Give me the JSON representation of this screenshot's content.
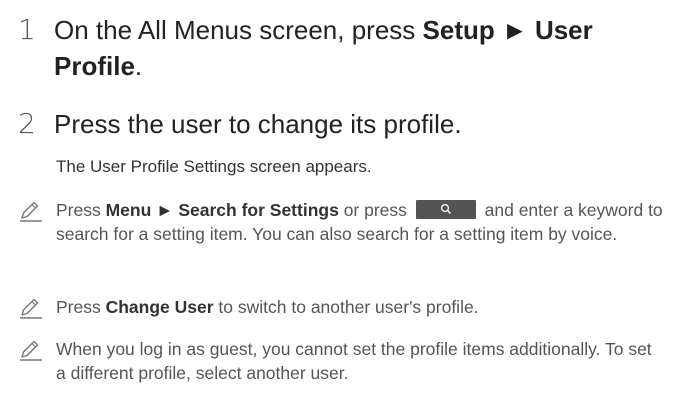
{
  "steps": [
    {
      "number": "1",
      "text_before": "On the All Menus screen, press ",
      "bold1": "Setup",
      "arrow": " ► ",
      "bold2": "User Profile",
      "text_after": "."
    },
    {
      "number": "2",
      "text": "Press the user to change its profile."
    }
  ],
  "step2_result": "The User Profile Settings screen appears.",
  "notes": [
    {
      "pre": "Press ",
      "b1": "Menu",
      "arrow": " ► ",
      "b2": "Search for Settings",
      "mid": " or press ",
      "icon": "search-icon",
      "post": " and enter a keyword to search for a setting item. You can also search for a setting item by voice."
    },
    {
      "pre": "Press ",
      "b1": "Change User",
      "post": " to switch to another user's profile."
    },
    {
      "text": "When you log in as guest, you cannot set the profile items additionally. To set a different profile, select another user."
    }
  ],
  "colors": {
    "search_button_bg": "#545454",
    "note_icon": "#777777"
  }
}
